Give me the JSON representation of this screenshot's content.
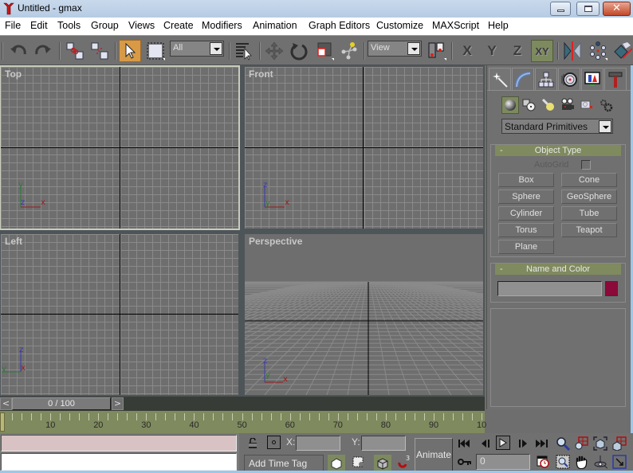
{
  "window": {
    "title": "Untitled - gmax",
    "controls": {
      "minimize": "minimize-icon",
      "maximize": "restore-icon",
      "close": "close-icon"
    }
  },
  "menu": [
    "File",
    "Edit",
    "Tools",
    "Group",
    "Views",
    "Create",
    "Modifiers",
    "Animation",
    "Graph Editors",
    "Customize",
    "MAXScript",
    "Help"
  ],
  "toolbar": {
    "selection_filter": "All",
    "ref_coord_system": "View",
    "axis_buttons": [
      "X",
      "Y",
      "Z",
      "XY"
    ],
    "active_axis": "XY",
    "active_tool": "select"
  },
  "viewports": [
    {
      "label": "Top",
      "axes": {
        "a": "y",
        "b": "x",
        "c": "z"
      }
    },
    {
      "label": "Front",
      "axes": {
        "a": "z",
        "b": "x",
        "c": "y"
      }
    },
    {
      "label": "Left",
      "axes": {
        "a": "z",
        "b": "y",
        "c": "x"
      }
    },
    {
      "label": "Perspective",
      "axes": {
        "a": "z",
        "b": "x",
        "c": "y"
      }
    }
  ],
  "command_panel": {
    "tabs": [
      "create",
      "modify",
      "hierarchy",
      "motion",
      "display",
      "utilities"
    ],
    "active_tab": "create",
    "categories": [
      "geometry",
      "shapes",
      "lights",
      "cameras",
      "helpers",
      "space-warps"
    ],
    "active_category": "geometry",
    "dropdown": "Standard Primitives",
    "object_type": {
      "title": "Object Type",
      "collapse": "-",
      "autogrid_label": "AutoGrid",
      "autogrid_checked": false,
      "buttons": [
        "Box",
        "Cone",
        "Sphere",
        "GeoSphere",
        "Cylinder",
        "Tube",
        "Torus",
        "Teapot",
        "Plane"
      ]
    },
    "name_and_color": {
      "title": "Name and Color",
      "collapse": "-",
      "name_value": "",
      "color": "#8b0a3a"
    }
  },
  "timeline": {
    "slider_label": "0 / 100",
    "prev": "<",
    "next": ">",
    "current_frame": 0,
    "total_frames": 100,
    "ticks": [
      "10",
      "20",
      "30",
      "40",
      "50",
      "60",
      "70",
      "80",
      "90",
      "10"
    ]
  },
  "status": {
    "x_label": "X:",
    "y_label": "Y:",
    "x_value": "",
    "y_value": "",
    "add_time_tag": "Add Time Tag",
    "animate": "Animate",
    "frame_value": "0",
    "snap_superscript": "3"
  },
  "colors": {
    "accent": "#d89a46",
    "rollout_header": "#7f8a5e",
    "trackbar": "#7f8a5e",
    "axis_x": "#9c1c1c",
    "axis_y": "#2e7a3a",
    "axis_z": "#3a3aa8"
  }
}
